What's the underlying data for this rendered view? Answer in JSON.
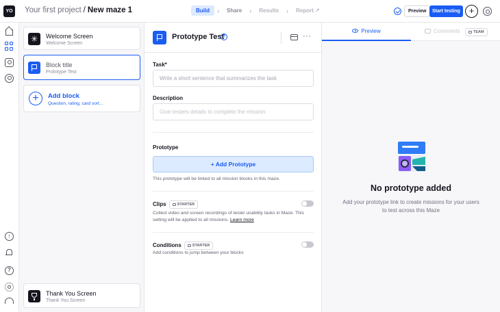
{
  "app": {
    "logo": "YO",
    "project": "Your first project",
    "separator": "/",
    "maze_name": "New maze 1"
  },
  "steps": {
    "build": "Build",
    "share": "Share",
    "results": "Results",
    "report": "Report"
  },
  "toolbar": {
    "preview_label": "Preview",
    "start_label": "Start testing",
    "plus": "+"
  },
  "blocks": {
    "welcome_title": "Welcome Screen",
    "welcome_subtitle": "Welcome Screen",
    "block_title": "Block title",
    "block_subtitle": "Prototype Test",
    "add_title": "Add block",
    "add_subtitle": "Question, rating, card sort...",
    "thanks_title": "Thank You Screen",
    "thanks_subtitle": "Thank You Screen"
  },
  "editor": {
    "title": "Prototype Test",
    "more": "···",
    "task_label": "Task*",
    "task_placeholder": "Write a short sentence that summarizes the task",
    "description_label": "Description",
    "description_placeholder": "Give testers details to complete the mission",
    "prototype_label": "Prototype",
    "add_prototype": "+ Add Prototype",
    "prototype_note": "This prototype will be linked to all mission blocks in this maze.",
    "clips_label": "Clips",
    "plan_badge": "STARTER",
    "clips_desc": "Collect video and screen recordings of tester usability tasks in Maze. This setting will be applied to all missions.",
    "learn_more": "Learn more",
    "conditions_label": "Conditions",
    "conditions_desc": "Add conditions to jump between your blocks"
  },
  "preview": {
    "tab_preview": "Preview",
    "tab_comments": "Comments",
    "team_badge": "TEAM",
    "empty_title": "No prototype added",
    "empty_desc": "Add your prototype link to create missions for your users to test across this Maze"
  },
  "colors": {
    "accent": "#1a5cf4",
    "dark": "#15151f",
    "active_step_bg": "#dde9ff",
    "add_prototype_bg": "#dcebff"
  },
  "toggles": {
    "clips_enabled": false,
    "conditions_enabled": false
  }
}
